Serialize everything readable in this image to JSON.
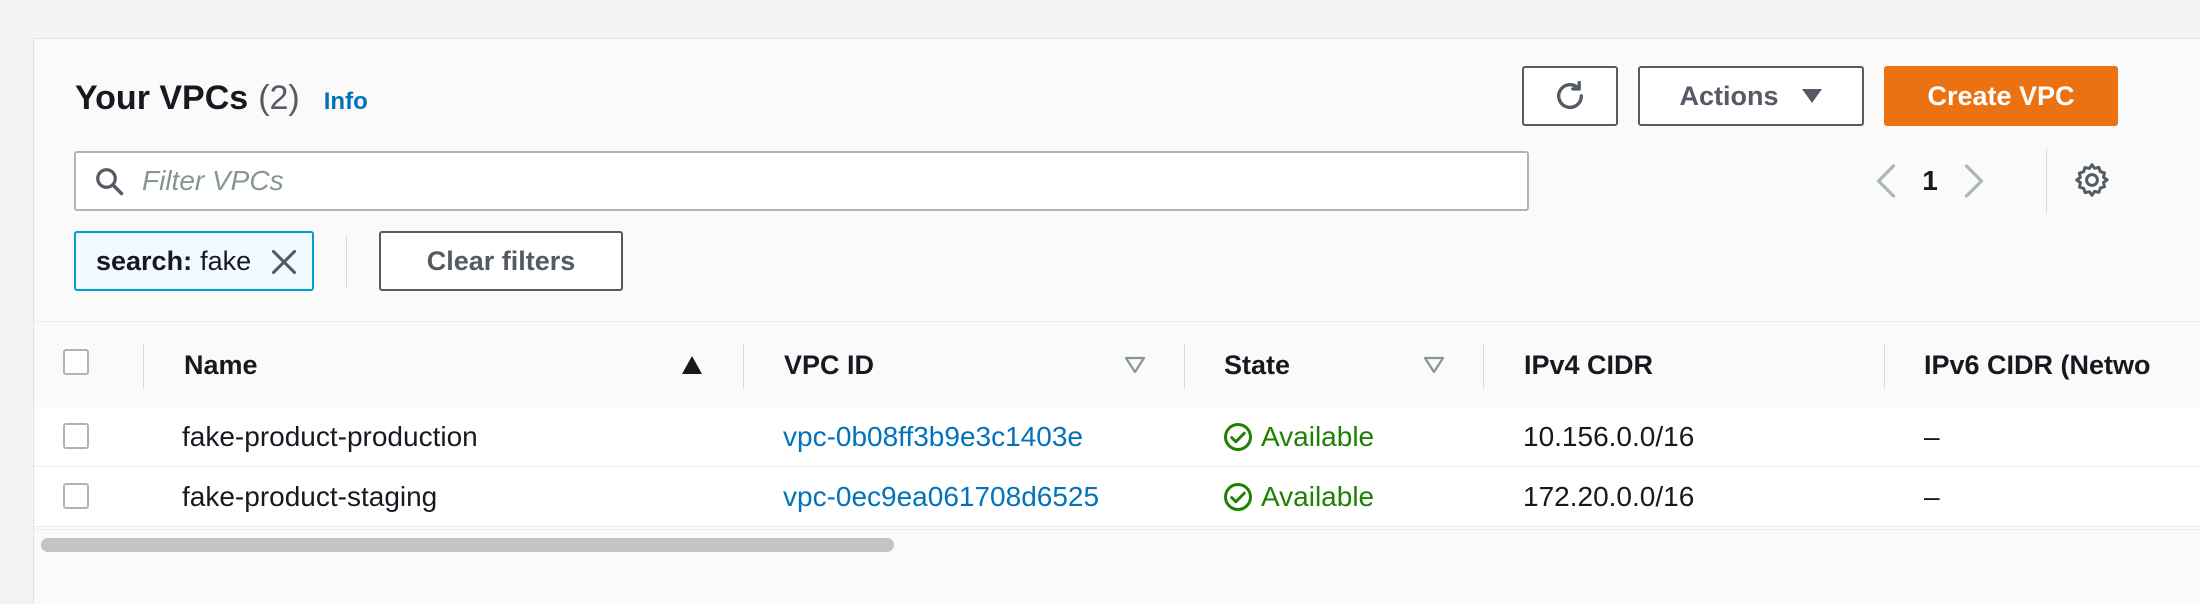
{
  "header": {
    "title": "Your VPCs",
    "count": "(2)",
    "info_link": "Info"
  },
  "toolbar": {
    "refresh_icon": "refresh-icon",
    "actions_label": "Actions",
    "create_label": "Create VPC",
    "accent_color": "#ec7211"
  },
  "search": {
    "placeholder": "Filter VPCs",
    "value": ""
  },
  "pagination": {
    "current_page": "1"
  },
  "filter_token": {
    "key": "search:",
    "value": "fake"
  },
  "clear_filters_label": "Clear filters",
  "table": {
    "columns": [
      "Name",
      "VPC ID",
      "State",
      "IPv4 CIDR",
      "IPv6 CIDR (Netwo"
    ],
    "sort": {
      "column": "Name",
      "direction": "ascending"
    },
    "rows": [
      {
        "name": "fake-product-production",
        "vpc_id": "vpc-0b08ff3b9e3c1403e",
        "state": "Available",
        "ipv4_cidr": "10.156.0.0/16",
        "ipv6_cidr": "–"
      },
      {
        "name": "fake-product-staging",
        "vpc_id": "vpc-0ec9ea061708d6525",
        "state": "Available",
        "ipv4_cidr": "172.20.0.0/16",
        "ipv6_cidr": "–"
      }
    ]
  },
  "colors": {
    "link": "#0073bb",
    "status_available": "#1d8102",
    "filter_token_border": "#00a1c9"
  }
}
